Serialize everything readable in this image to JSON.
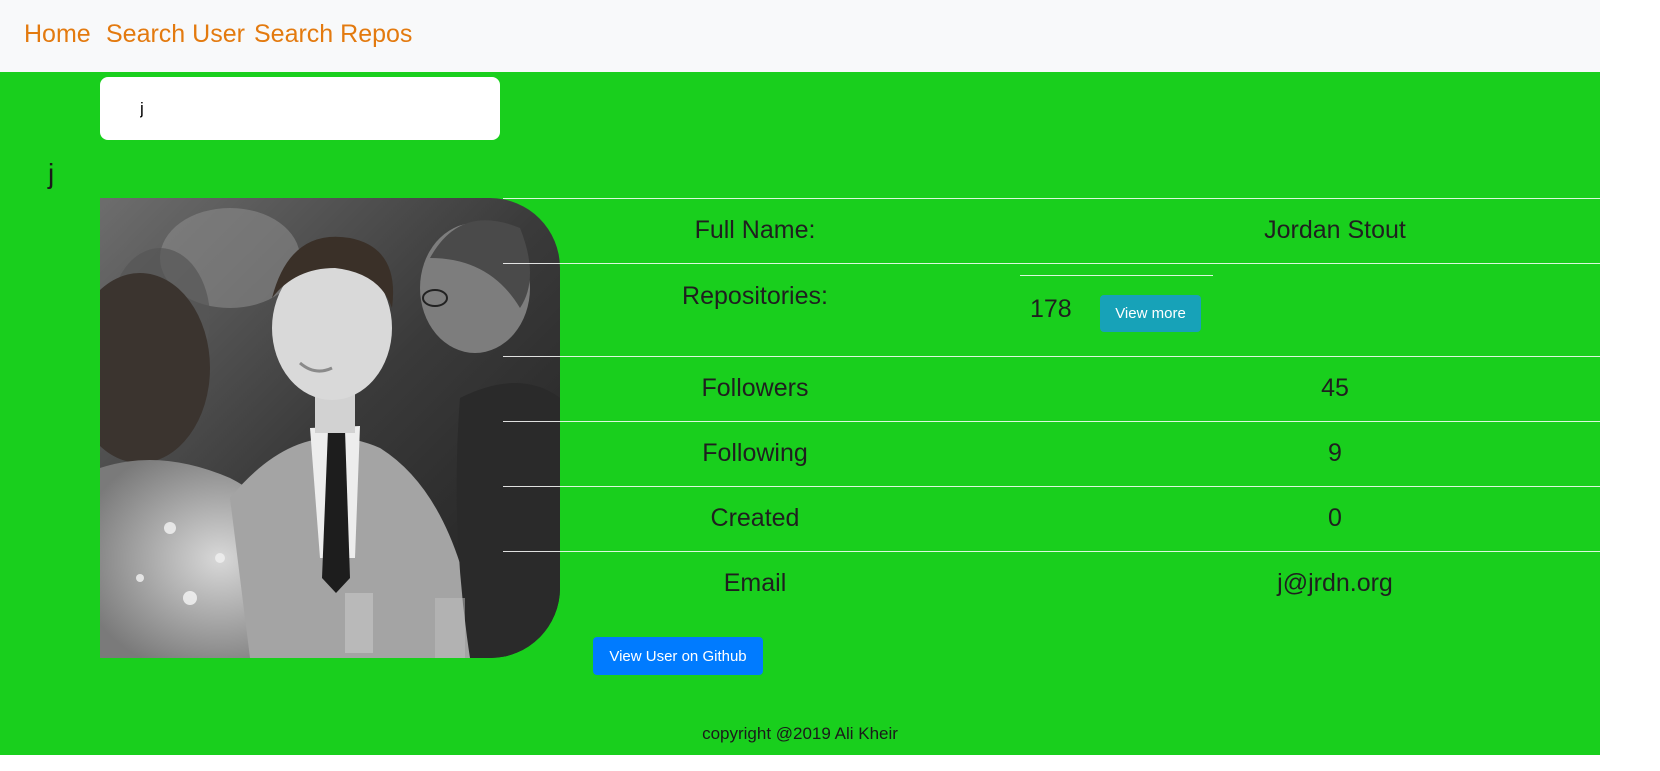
{
  "nav": {
    "home": "Home",
    "search_user": "Search User",
    "search_repos": "Search Repos",
    "link_color": "#e37a0f"
  },
  "search": {
    "value": "j"
  },
  "user": {
    "login": "j",
    "photo_icon": "user-photo"
  },
  "profile": {
    "full_name_label": "Full Name:",
    "full_name": "Jordan Stout",
    "repos_label": "Repositories:",
    "repos": "178",
    "view_more": "View more",
    "followers_label": "Followers",
    "followers": "45",
    "following_label": "Following",
    "following": "9",
    "created_label": "Created",
    "created": "0",
    "email_label": "Email",
    "email": "j@jrdn.org"
  },
  "github_button": "View User on Github",
  "footer": {
    "copyright": "copyright @2019 Ali Kheir"
  },
  "colors": {
    "background": "#19cf1d",
    "navbar": "#f8f9fa",
    "view_more_button": "#17a2b8",
    "github_button": "#007bff"
  }
}
